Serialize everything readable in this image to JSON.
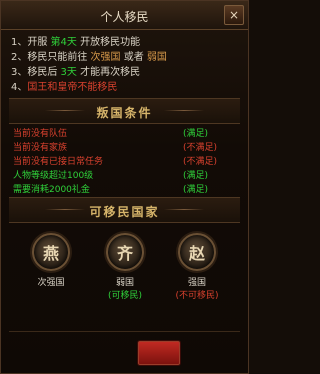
{
  "title": "个人移民",
  "close_glyph": "×",
  "rules": [
    {
      "parts": [
        {
          "t": "1、开服 ",
          "c": ""
        },
        {
          "t": "第4天",
          "c": "green"
        },
        {
          "t": " 开放移民功能",
          "c": ""
        }
      ]
    },
    {
      "parts": [
        {
          "t": "2、移民只能前往 ",
          "c": ""
        },
        {
          "t": "次强国",
          "c": "orange"
        },
        {
          "t": " 或者 ",
          "c": ""
        },
        {
          "t": "弱国",
          "c": "orange"
        }
      ]
    },
    {
      "parts": [
        {
          "t": "3、移民后 ",
          "c": ""
        },
        {
          "t": "3天",
          "c": "green"
        },
        {
          "t": " 才能再次移民",
          "c": ""
        }
      ]
    },
    {
      "parts": [
        {
          "t": "4、",
          "c": ""
        },
        {
          "t": "国王和皇帝不能移民",
          "c": "red"
        }
      ]
    }
  ],
  "section_rebel": "叛国条件",
  "conditions": [
    {
      "label": "当前没有队伍",
      "label_color": "red",
      "status": "(满足)",
      "status_color": "green"
    },
    {
      "label": "当前没有家族",
      "label_color": "red",
      "status": "(不满足)",
      "status_color": "red"
    },
    {
      "label": "当前没有已接日常任务",
      "label_color": "red",
      "status": "(不满足)",
      "status_color": "red"
    },
    {
      "label": "人物等级超过100级",
      "label_color": "green",
      "status": "(满足)",
      "status_color": "green"
    },
    {
      "label": "需要消耗2000礼金",
      "label_color": "green",
      "status": "(满足)",
      "status_color": "green"
    }
  ],
  "section_countries": "可移民国家",
  "countries": [
    {
      "glyph": "燕",
      "name": "次强国",
      "status": "",
      "status_color": ""
    },
    {
      "glyph": "齐",
      "name": "弱国",
      "status": "(可移民)",
      "status_color": "green"
    },
    {
      "glyph": "赵",
      "name": "强国",
      "status": "(不可移民)",
      "status_color": "red"
    }
  ],
  "colors": {
    "green": "#2fd13a",
    "red": "#d8412e",
    "orange": "#d89a4b",
    "gold": "#d6b46a",
    "confirm_button": "#c02a22"
  }
}
